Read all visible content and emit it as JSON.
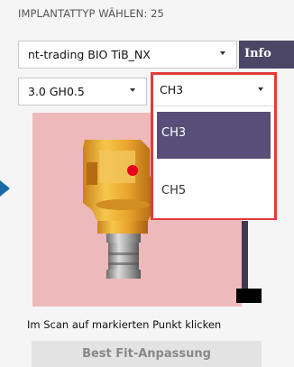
{
  "header": {
    "label": "IMPLANTATTYP WÄHLEN: 25"
  },
  "implant": {
    "selected": "nt-trading BIO TiB_NX",
    "info_label": "Info"
  },
  "size": {
    "selected": "3.0 GH0.5"
  },
  "variant": {
    "selected": "CH3",
    "options": [
      "CH3",
      "CH5"
    ]
  },
  "instruction": "Im Scan auf markierten Punkt klicken",
  "best_fit_label": "Best Fit-Anpassung",
  "colors": {
    "accent": "#574f78",
    "highlight_border": "#e23b3b",
    "preview_bg": "#eeb9ba",
    "marker": "#e8001c"
  }
}
